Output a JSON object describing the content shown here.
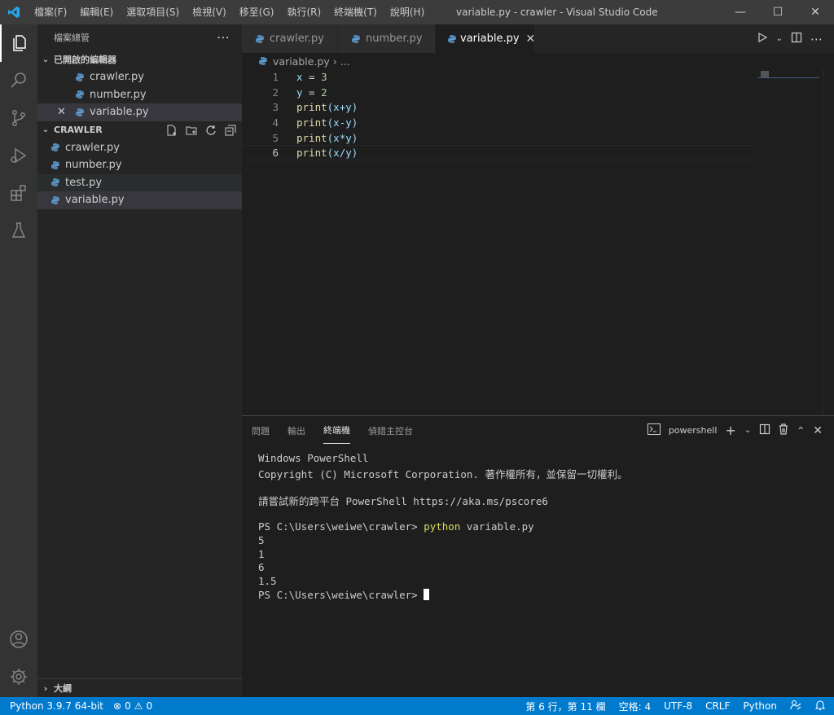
{
  "window": {
    "title": "variable.py - crawler - Visual Studio Code",
    "menu": [
      "檔案(F)",
      "編輯(E)",
      "選取項目(S)",
      "檢視(V)",
      "移至(G)",
      "執行(R)",
      "終端機(T)",
      "說明(H)"
    ]
  },
  "sidebar": {
    "title": "檔案總管",
    "open_editors_label": "已開啟的編輯器",
    "open_editors": [
      "crawler.py",
      "number.py",
      "variable.py"
    ],
    "folder_label": "CRAWLER",
    "files": [
      "crawler.py",
      "number.py",
      "test.py",
      "variable.py"
    ],
    "outline_label": "大綱"
  },
  "tabs": [
    "crawler.py",
    "number.py",
    "variable.py"
  ],
  "breadcrumb": {
    "file": "variable.py",
    "more": "..."
  },
  "editor": {
    "line_numbers": [
      "1",
      "2",
      "3",
      "4",
      "5",
      "6"
    ],
    "lines": [
      {
        "a": "x",
        "b": " = ",
        "c": "3"
      },
      {
        "a": "y",
        "b": " = ",
        "c": "2"
      },
      {
        "a": "print",
        "b": "(x+y)"
      },
      {
        "a": "print",
        "b": "(x-y)"
      },
      {
        "a": "print",
        "b": "(x*y)"
      },
      {
        "a": "print",
        "b": "(x/y)"
      }
    ]
  },
  "panel": {
    "tabs": [
      "問題",
      "輸出",
      "終端機",
      "偵錯主控台"
    ],
    "shell": "powershell",
    "terminal": {
      "l1": "Windows PowerShell",
      "l2": "Copyright (C) Microsoft Corporation. 著作權所有，並保留一切權利。",
      "l3": "請嘗試新的跨平台 PowerShell https://aka.ms/pscore6",
      "prompt": "PS C:\\Users\\weiwe\\crawler> ",
      "cmd": "python",
      "cmd_arg": " variable.py",
      "out": [
        "5",
        "1",
        "6",
        "1.5"
      ]
    }
  },
  "status": {
    "python": "Python 3.9.7 64-bit",
    "errors": "0",
    "warnings": "0",
    "position": "第 6 行，第 11 欄",
    "spaces": "空格: 4",
    "encoding": "UTF-8",
    "eol": "CRLF",
    "language": "Python"
  }
}
